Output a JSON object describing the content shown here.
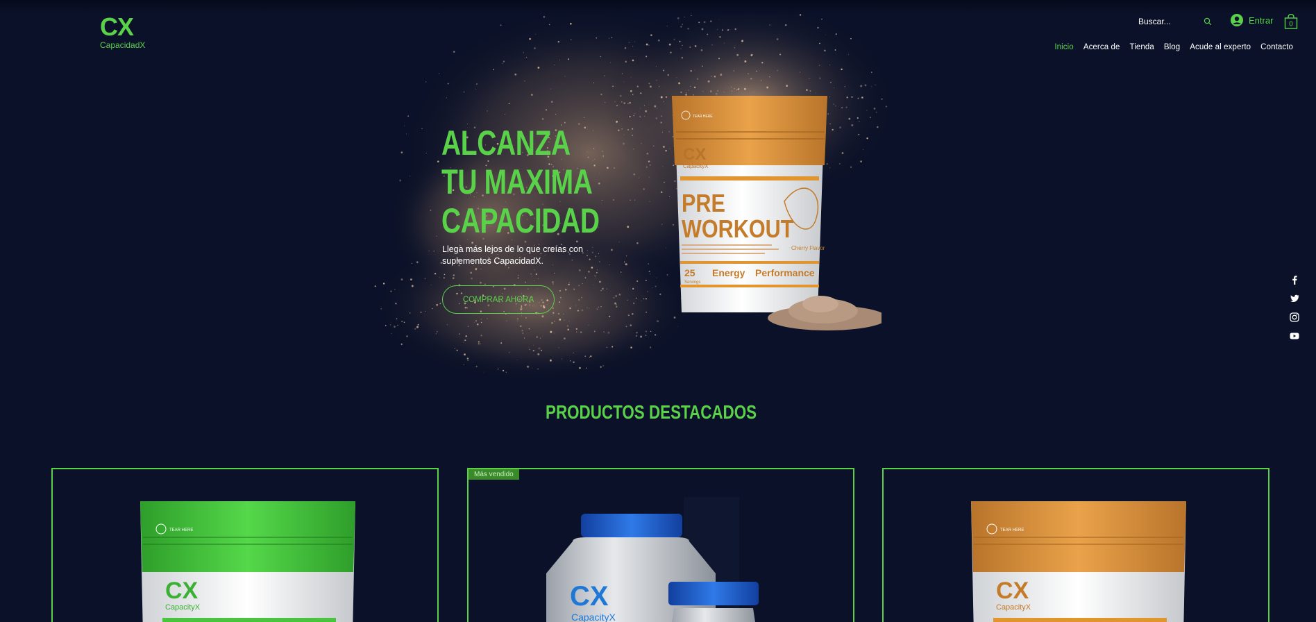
{
  "brand": {
    "mark": "CX",
    "name": "CapacidadX"
  },
  "header": {
    "search_placeholder": "Buscar...",
    "login_label": "Entrar",
    "cart_count": "0"
  },
  "nav": {
    "items": [
      {
        "label": "Inicio",
        "active": true
      },
      {
        "label": "Acerca de"
      },
      {
        "label": "Tienda"
      },
      {
        "label": "Blog"
      },
      {
        "label": "Acude al experto"
      },
      {
        "label": "Contacto"
      }
    ]
  },
  "hero": {
    "title_lines": [
      "ALCANZA",
      "TU MAXIMA",
      "CAPACIDAD"
    ],
    "subtitle": "Llega más lejos de lo que creías con suplementos CapacidadX.",
    "cta": "COMPRAR AHORA",
    "product": {
      "brand": "CX",
      "brand_sub": "CapacityX",
      "tear": "TEAR HERE",
      "name_line1": "PRE",
      "name_line2": "WORKOUT",
      "flavor": "Cherry Flavor",
      "servings": "25",
      "servings_label": "Servings",
      "tag1": "Energy",
      "tag2": "Performance"
    }
  },
  "social": [
    "facebook-icon",
    "twitter-icon",
    "instagram-icon",
    "youtube-icon"
  ],
  "featured": {
    "title": "PRODUCTOS DESTACADOS",
    "cards": [
      {
        "ribbon": "",
        "brand": "CX",
        "brand_sub": "CapacityX",
        "tear": "TEAR HERE",
        "color": "#3cc83a"
      },
      {
        "ribbon": "Más vendido",
        "brand": "CX",
        "brand_sub": "CapacityX",
        "color": "#1a5fd0"
      },
      {
        "ribbon": "",
        "brand": "CX",
        "brand_sub": "CapacityX",
        "tear": "TEAR HERE",
        "color": "#e0952e"
      }
    ]
  },
  "colors": {
    "background": "#0b1128",
    "accent": "#59d24a",
    "text": "#ffffff"
  }
}
